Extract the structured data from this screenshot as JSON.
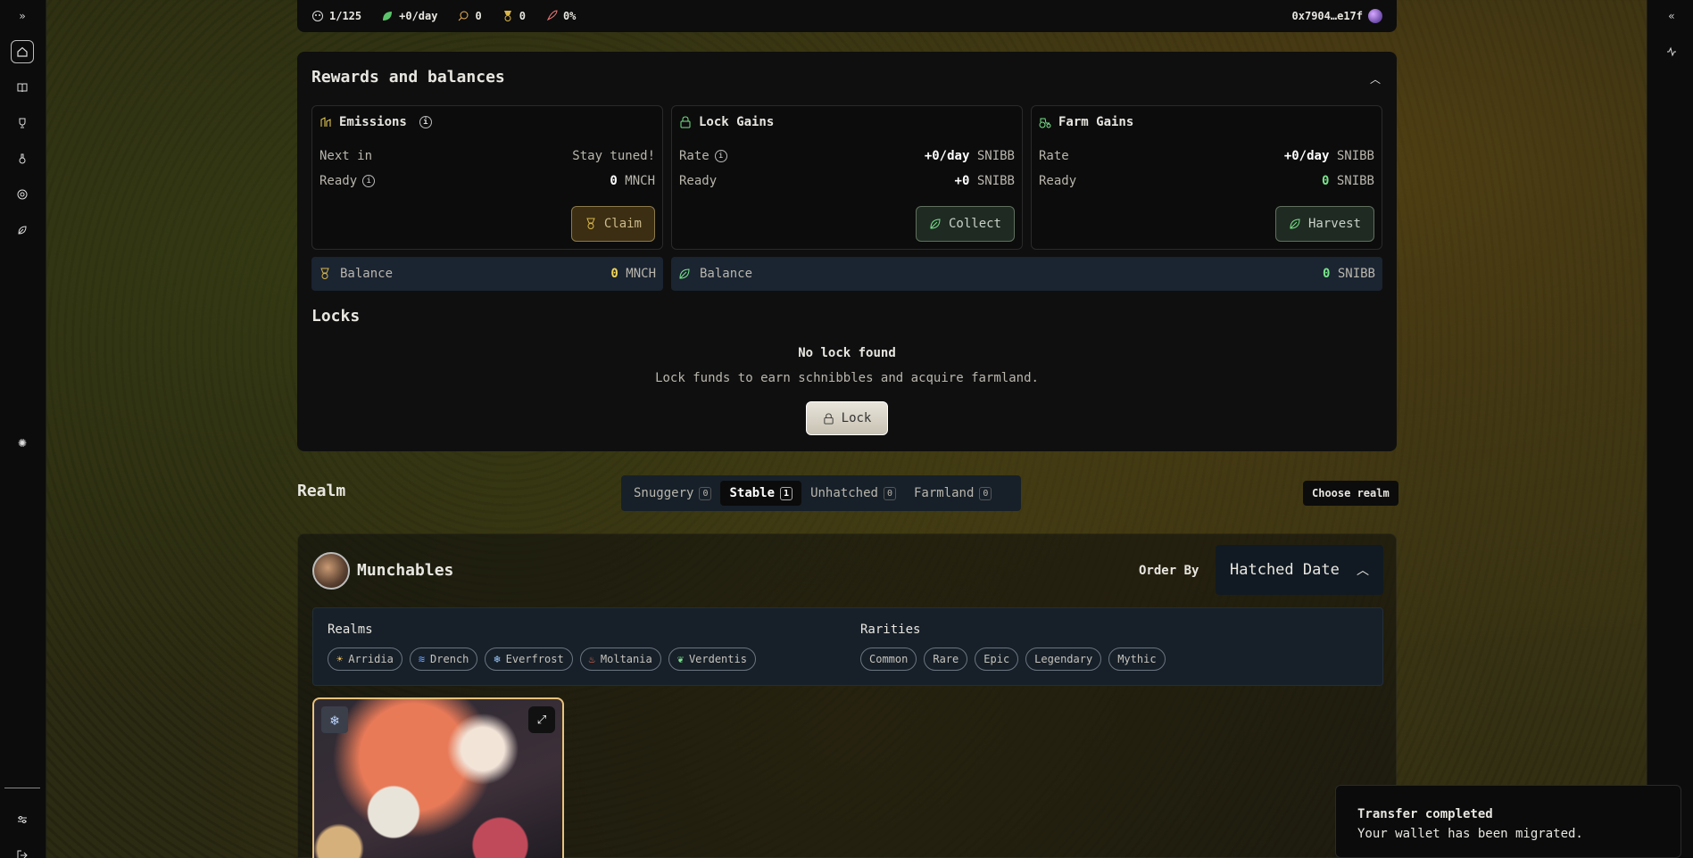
{
  "topbar": {
    "munchables_count": "1/125",
    "rate": "+0/day",
    "food": "0",
    "medals": "0",
    "boost": "0%",
    "wallet": "0x7904…e17f"
  },
  "rewards": {
    "title": "Rewards and balances",
    "emissions": {
      "title": "Emissions",
      "next_in_label": "Next in",
      "next_in_value": "Stay tuned!",
      "ready_label": "Ready",
      "ready_value": "0",
      "ready_unit": "MNCH",
      "button": "Claim"
    },
    "lock_gains": {
      "title": "Lock Gains",
      "rate_label": "Rate",
      "rate_value": "+0/day",
      "rate_unit": "SNIBB",
      "ready_label": "Ready",
      "ready_value": "+0",
      "ready_unit": "SNIBB",
      "button": "Collect"
    },
    "farm_gains": {
      "title": "Farm Gains",
      "rate_label": "Rate",
      "rate_value": "+0/day",
      "rate_unit": "SNIBB",
      "ready_label": "Ready",
      "ready_value": "0",
      "ready_unit": "SNIBB",
      "button": "Harvest"
    },
    "balance_mnch": {
      "label": "Balance",
      "value": "0",
      "unit": "MNCH"
    },
    "balance_snibb": {
      "label": "Balance",
      "value": "0",
      "unit": "SNIBB"
    }
  },
  "locks": {
    "title": "Locks",
    "empty_title": "No lock found",
    "empty_desc": "Lock funds to earn schnibbles and acquire farmland.",
    "button": "Lock"
  },
  "realm": {
    "title": "Realm",
    "tabs": [
      {
        "label": "Snuggery",
        "count": "0"
      },
      {
        "label": "Stable",
        "count": "1"
      },
      {
        "label": "Unhatched",
        "count": "0"
      },
      {
        "label": "Farmland",
        "count": "0"
      }
    ],
    "choose_realm": "Choose realm"
  },
  "munchables": {
    "title": "Munchables",
    "order_by_label": "Order By",
    "order_by_value": "Hatched Date",
    "realms_label": "Realms",
    "realms": [
      "Arridia",
      "Drench",
      "Everfrost",
      "Moltania",
      "Verdentis"
    ],
    "rarities_label": "Rarities",
    "rarities": [
      "Common",
      "Rare",
      "Epic",
      "Legendary",
      "Mythic"
    ]
  },
  "toast": {
    "title": "Transfer completed",
    "message": "Your wallet has been migrated."
  },
  "colors": {
    "mnch_yellow": "#f0d45a",
    "snibb_green": "#78e38a",
    "card_border": "#e9c27a"
  }
}
